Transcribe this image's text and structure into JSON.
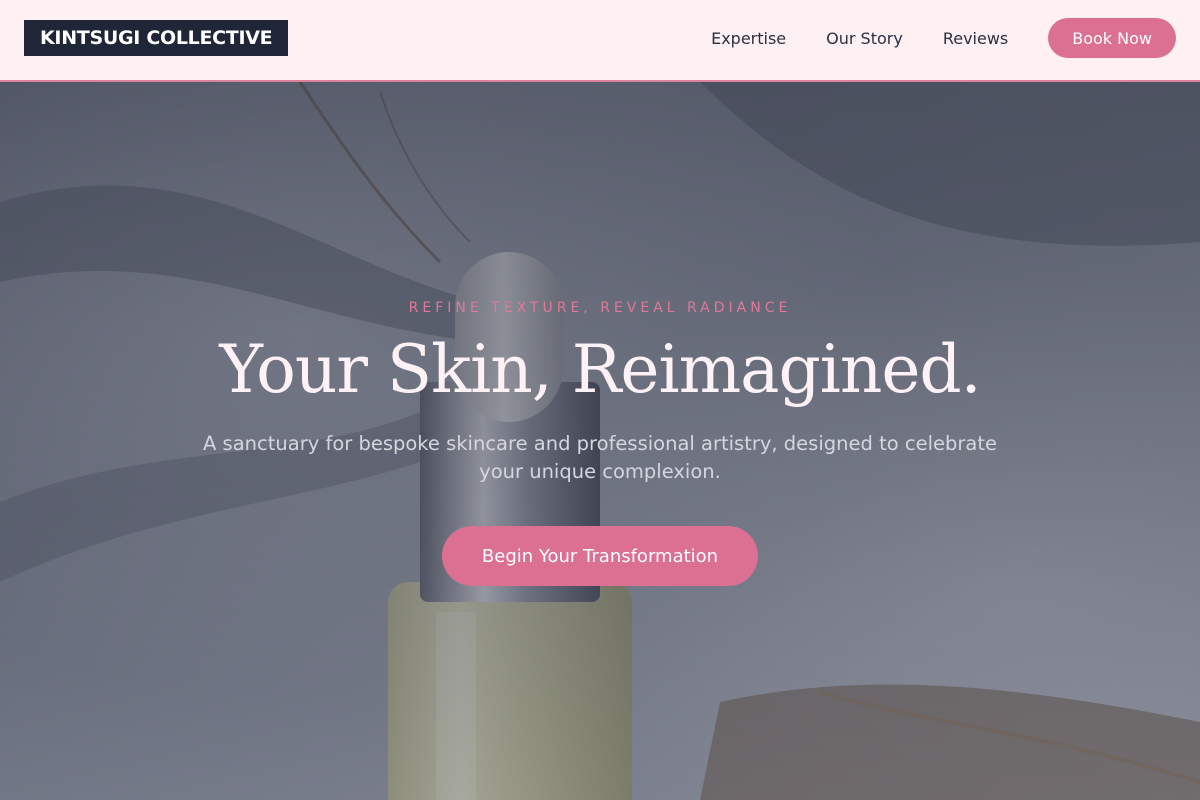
{
  "brand": {
    "name": "KINTSUGI COLLECTIVE"
  },
  "nav": {
    "links": [
      {
        "label": "Expertise"
      },
      {
        "label": "Our Story"
      },
      {
        "label": "Reviews"
      }
    ],
    "cta_label": "Book Now"
  },
  "hero": {
    "tagline": "REFINE TEXTURE, REVEAL RADIANCE",
    "headline": "Your Skin, Reimagined.",
    "subtitle": "A sanctuary for bespoke skincare and professional artistry, designed to celebrate your unique complexion.",
    "cta_label": "Begin Your Transformation",
    "image_subject": "serum-dropper-bottle"
  },
  "colors": {
    "accent": "#db7092",
    "nav_background": "#fff0f4",
    "logo_background": "#1e2638"
  }
}
